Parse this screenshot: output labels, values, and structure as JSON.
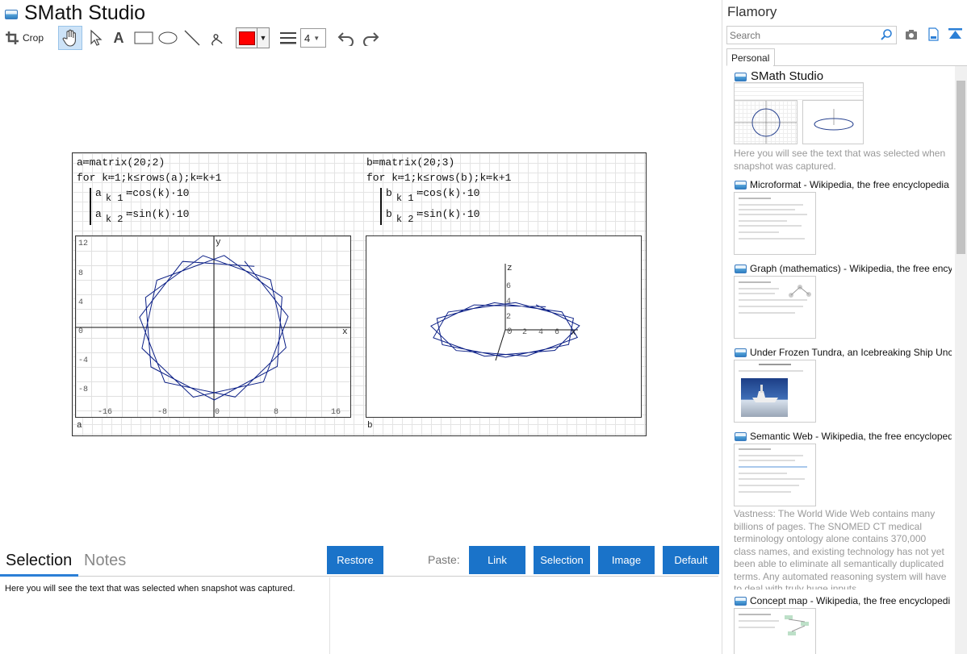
{
  "app": {
    "title": "SMath Studio"
  },
  "toolbar": {
    "crop_label": "Crop",
    "text_tool_label": "A",
    "color": "#ff0000",
    "line_width": "4"
  },
  "snapshot": {
    "left_code": {
      "line1": "a≔matrix(20;2)",
      "line2": "for k≔1;k≤rows(a);k≔k+1",
      "line3a": "a",
      "line3sub": "k 1",
      "line3b": "≔cos(k)·10",
      "line4a": "a",
      "line4sub": "k 2",
      "line4b": "≔sin(k)·10"
    },
    "right_code": {
      "line1": "b≔matrix(20;3)",
      "line2": "for k≔1;k≤rows(b);k≔k+1",
      "line3a": "b",
      "line3sub": "k 1",
      "line3b": "≔cos(k)·10",
      "line4a": "b",
      "line4sub": "k 2",
      "line4b": "≔sin(k)·10"
    },
    "plot2d": {
      "y_label": "y",
      "x_label": "x",
      "y_ticks": [
        "12",
        "8",
        "4",
        "0",
        "-4",
        "-8"
      ],
      "x_ticks": [
        "-16",
        "-8",
        "0",
        "8",
        "16"
      ],
      "name": "a"
    },
    "plot3d": {
      "z_label": "z",
      "z_ticks": [
        "6",
        "4",
        "2"
      ],
      "origin": "0",
      "x_ticks": [
        "2",
        "4",
        "6"
      ],
      "x_label": "x",
      "name": "b"
    },
    "line_color": "#0b1f86"
  },
  "bottom": {
    "tab_selection": "Selection",
    "tab_notes": "Notes",
    "restore": "Restore",
    "paste_label": "Paste:",
    "link": "Link",
    "selection": "Selection",
    "image": "Image",
    "default": "Default",
    "selection_text": "Here you will see the text that was selected when snapshot was captured."
  },
  "sidebar": {
    "title": "Flamory",
    "search_placeholder": "Search",
    "tab_personal": "Personal",
    "cards": [
      {
        "title": "SMath Studio",
        "caption": "Here you will see the text that was selected when snapshot was captured."
      },
      {
        "title": "Microformat - Wikipedia, the free encyclopedia"
      },
      {
        "title": "Graph (mathematics) - Wikipedia, the free encyc"
      },
      {
        "title": "Under Frozen Tundra, an Icebreaking Ship Unco"
      },
      {
        "title": "Semantic Web - Wikipedia, the free encycloped",
        "caption": "Vastness: The World Wide Web contains many billions of pages. The SNOMED CT medical terminology ontology alone contains 370,000 class names, and existing technology has not yet been able to eliminate all semantically duplicated terms. Any automated reasoning system will have to deal with truly huge inputs."
      },
      {
        "title": "Concept map - Wikipedia, the free encyclopedi"
      }
    ]
  }
}
